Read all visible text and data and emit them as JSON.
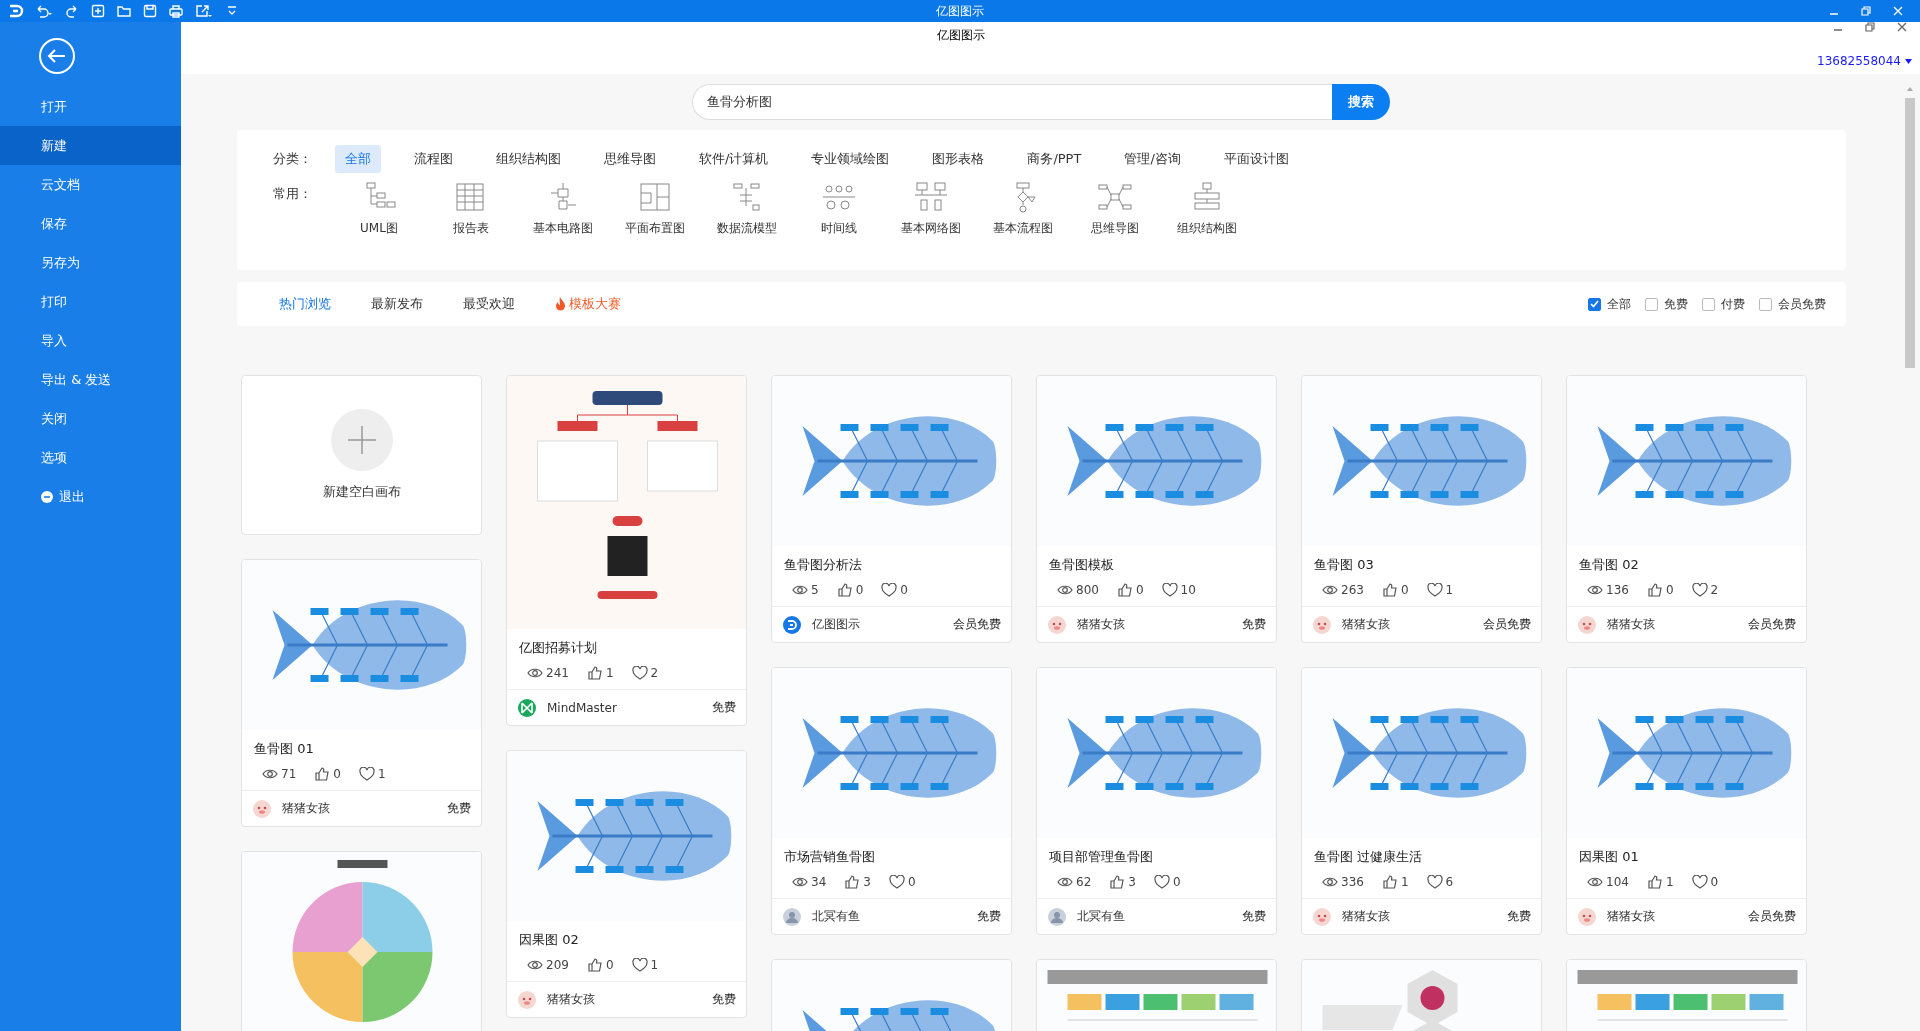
{
  "titlebar": {
    "title": "亿图图示"
  },
  "header": {
    "title": "亿图图示",
    "account": "13682558044"
  },
  "sidebar": {
    "items": [
      {
        "label": "打开",
        "selected": false,
        "kind": "plain"
      },
      {
        "label": "新建",
        "selected": true,
        "kind": "plain"
      },
      {
        "label": "云文档",
        "selected": false,
        "kind": "plain"
      },
      {
        "label": "保存",
        "selected": false,
        "kind": "plain"
      },
      {
        "label": "另存为",
        "selected": false,
        "kind": "plain"
      },
      {
        "label": "打印",
        "selected": false,
        "kind": "plain"
      },
      {
        "label": "导入",
        "selected": false,
        "kind": "plain"
      },
      {
        "label": "导出 & 发送",
        "selected": false,
        "kind": "plain"
      },
      {
        "label": "关闭",
        "selected": false,
        "kind": "plain"
      },
      {
        "label": "选项",
        "selected": false,
        "kind": "plain"
      },
      {
        "label": "退出",
        "selected": false,
        "kind": "exit"
      }
    ]
  },
  "search": {
    "value": "鱼骨分析图",
    "button": "搜索"
  },
  "categories": {
    "label": "分类：",
    "items": [
      {
        "label": "全部",
        "selected": true
      },
      {
        "label": "流程图",
        "selected": false
      },
      {
        "label": "组织结构图",
        "selected": false
      },
      {
        "label": "思维导图",
        "selected": false
      },
      {
        "label": "软件/计算机",
        "selected": false
      },
      {
        "label": "专业领域绘图",
        "selected": false
      },
      {
        "label": "图形表格",
        "selected": false
      },
      {
        "label": "商务/PPT",
        "selected": false
      },
      {
        "label": "管理/咨询",
        "selected": false
      },
      {
        "label": "平面设计图",
        "selected": false
      }
    ]
  },
  "common": {
    "label": "常用：",
    "items": [
      {
        "label": "UML图"
      },
      {
        "label": "报告表"
      },
      {
        "label": "基本电路图"
      },
      {
        "label": "平面布置图"
      },
      {
        "label": "数据流模型"
      },
      {
        "label": "时间线"
      },
      {
        "label": "基本网络图"
      },
      {
        "label": "基本流程图"
      },
      {
        "label": "思维导图"
      },
      {
        "label": "组织结构图"
      }
    ]
  },
  "feed_tabs": [
    {
      "label": "热门浏览",
      "selected": true,
      "kind": "plain"
    },
    {
      "label": "最新发布",
      "selected": false,
      "kind": "plain"
    },
    {
      "label": "最受欢迎",
      "selected": false,
      "kind": "plain"
    },
    {
      "label": "模板大赛",
      "selected": false,
      "kind": "contest"
    }
  ],
  "filters": [
    {
      "label": "全部",
      "checked": true
    },
    {
      "label": "免费",
      "checked": false
    },
    {
      "label": "付费",
      "checked": false
    },
    {
      "label": "会员免费",
      "checked": false
    }
  ],
  "columns": [
    [
      {
        "kind": "new",
        "label": "新建空白画布"
      },
      {
        "kind": "template",
        "thumbnail": {
          "kind": "fishbone"
        },
        "title": "鱼骨图 01",
        "views": "71",
        "likes": "0",
        "favorites": "1",
        "author": "猪猪女孩",
        "avatar": {
          "kind": "cartoon"
        },
        "price": "免费"
      },
      {
        "kind": "template",
        "thumbnail": {
          "kind": "swot"
        }
      }
    ],
    [
      {
        "kind": "template",
        "thumbnail": {
          "kind": "poster"
        },
        "title": "亿图招募计划",
        "views": "241",
        "likes": "1",
        "favorites": "2",
        "author": "MindMaster",
        "avatar": {
          "kind": "mindmaster"
        },
        "price": "免费"
      },
      {
        "kind": "template",
        "thumbnail": {
          "kind": "fishbone"
        },
        "title": "因果图 02",
        "views": "209",
        "likes": "0",
        "favorites": "1",
        "author": "猪猪女孩",
        "avatar": {
          "kind": "cartoon"
        },
        "price": "免费"
      }
    ],
    [
      {
        "kind": "template",
        "thumbnail": {
          "kind": "fishbone"
        },
        "title": "鱼骨图分析法",
        "views": "5",
        "likes": "0",
        "favorites": "0",
        "author": "亿图图示",
        "avatar": {
          "kind": "edraw"
        },
        "price": "会员免费"
      },
      {
        "kind": "template",
        "thumbnail": {
          "kind": "fishbone"
        },
        "title": "市场营销鱼骨图",
        "views": "34",
        "likes": "3",
        "favorites": "0",
        "author": "北冥有鱼",
        "avatar": {
          "kind": "photo"
        },
        "price": "免费"
      },
      {
        "kind": "template",
        "thumbnail": {
          "kind": "fishbone"
        }
      }
    ],
    [
      {
        "kind": "template",
        "thumbnail": {
          "kind": "fishbone"
        },
        "title": "鱼骨图模板",
        "views": "800",
        "likes": "0",
        "favorites": "10",
        "author": "猪猪女孩",
        "avatar": {
          "kind": "cartoon"
        },
        "price": "免费"
      },
      {
        "kind": "template",
        "thumbnail": {
          "kind": "fishbone"
        },
        "title": "项目部管理鱼骨图",
        "views": "62",
        "likes": "3",
        "favorites": "0",
        "author": "北冥有鱼",
        "avatar": {
          "kind": "photo"
        },
        "price": "免费"
      },
      {
        "kind": "template",
        "thumbnail": {
          "kind": "table"
        }
      }
    ],
    [
      {
        "kind": "template",
        "thumbnail": {
          "kind": "fishbone"
        },
        "title": "鱼骨图 03",
        "views": "263",
        "likes": "0",
        "favorites": "1",
        "author": "猪猪女孩",
        "avatar": {
          "kind": "cartoon"
        },
        "price": "会员免费"
      },
      {
        "kind": "template",
        "thumbnail": {
          "kind": "fishbone"
        },
        "title": "鱼骨图 过健康生活",
        "views": "336",
        "likes": "1",
        "favorites": "6",
        "author": "猪猪女孩",
        "avatar": {
          "kind": "cartoon"
        },
        "price": "免费"
      },
      {
        "kind": "template",
        "thumbnail": {
          "kind": "hexagon"
        }
      }
    ],
    [
      {
        "kind": "template",
        "thumbnail": {
          "kind": "fishbone"
        },
        "title": "鱼骨图 02",
        "views": "136",
        "likes": "0",
        "favorites": "2",
        "author": "猪猪女孩",
        "avatar": {
          "kind": "cartoon"
        },
        "price": "会员免费"
      },
      {
        "kind": "template",
        "thumbnail": {
          "kind": "fishbone"
        },
        "title": "因果图 01",
        "views": "104",
        "likes": "1",
        "favorites": "0",
        "author": "猪猪女孩",
        "avatar": {
          "kind": "cartoon"
        },
        "price": "会员免费"
      },
      {
        "kind": "template",
        "thumbnail": {
          "kind": "table"
        }
      }
    ]
  ]
}
